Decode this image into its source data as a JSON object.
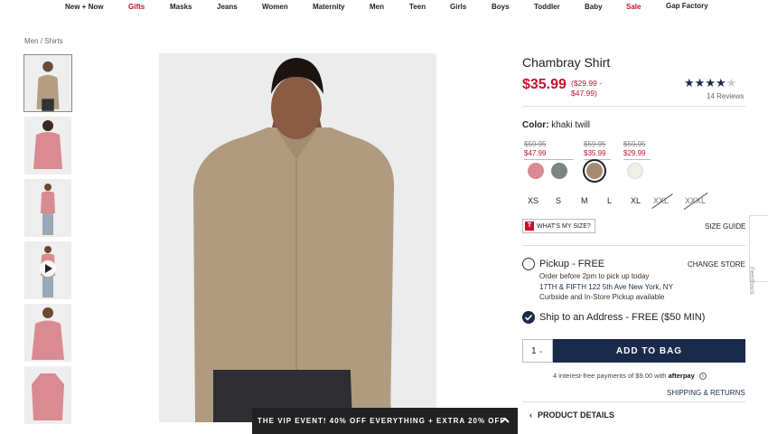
{
  "nav": {
    "items": [
      {
        "label": "New + Now",
        "sale": false
      },
      {
        "label": "Gifts",
        "sale": true
      },
      {
        "label": "Masks",
        "sale": false
      },
      {
        "label": "Jeans",
        "sale": false
      },
      {
        "label": "Women",
        "sale": false
      },
      {
        "label": "Maternity",
        "sale": false
      },
      {
        "label": "Men",
        "sale": false
      },
      {
        "label": "Teen",
        "sale": false
      },
      {
        "label": "Girls",
        "sale": false
      },
      {
        "label": "Boys",
        "sale": false
      },
      {
        "label": "Toddler",
        "sale": false
      },
      {
        "label": "Baby",
        "sale": false
      },
      {
        "label": "Sale",
        "sale": true
      },
      {
        "label": "Gap Factory",
        "sale": false
      }
    ]
  },
  "breadcrumb": "Men / Shirts",
  "product": {
    "title": "Chambray Shirt",
    "price": "$35.99",
    "price_range": "($29.99 - $47.99)",
    "rating": 4,
    "rating_max": 5,
    "reviews": "14 Reviews",
    "color_label": "Color:",
    "color_value": "khaki twill"
  },
  "swatch_prices": [
    {
      "old": "$59.95",
      "new": "$47.99"
    },
    {
      "old": "$59.95",
      "new": "$35.99"
    },
    {
      "old": "$59.95",
      "new": "$29.99"
    }
  ],
  "swatches": [
    {
      "name": "pink-chambray",
      "color": "#d98a92",
      "selected": false
    },
    {
      "name": "grey-chambray",
      "color": "#7c8582",
      "selected": false
    },
    {
      "name": "khaki-twill",
      "color": "#a58a72",
      "selected": true
    },
    {
      "name": "white",
      "color": "#efefe9",
      "selected": false
    }
  ],
  "sizes": [
    {
      "label": "XS",
      "available": true
    },
    {
      "label": "S",
      "available": true
    },
    {
      "label": "M",
      "available": true
    },
    {
      "label": "L",
      "available": true
    },
    {
      "label": "XL",
      "available": true
    },
    {
      "label": "XXL",
      "available": false
    },
    {
      "label": "XXXL",
      "available": false
    }
  ],
  "fit": {
    "icon_letter": "T",
    "label": "WHAT'S MY SIZE?"
  },
  "size_guide": "SIZE GUIDE",
  "pickup": {
    "label": "Pickup - FREE",
    "change_store": "CHANGE STORE",
    "line1": "Order before 2pm to pick up today",
    "line2": "17TH & FIFTH 122 5th Ave  New York, NY",
    "line3": "Curbside and In-Store Pickup available"
  },
  "ship": {
    "label": "Ship to an Address - FREE ($50 MIN)",
    "checked": true
  },
  "quantity": "1",
  "add_to_bag": "ADD TO BAG",
  "afterpay": {
    "text": "4 interest-free payments of $9.00 with",
    "brand": "afterpay",
    "info": "i"
  },
  "shipping_returns": "SHIPPING & RETURNS",
  "product_details": "PRODUCT DETAILS",
  "promo": "THE VIP EVENT! 40% OFF EVERYTHING + EXTRA 20% OFF",
  "feedback": "Feedback",
  "colors": {
    "sale_red": "#c8102e",
    "navy": "#1a2a4a"
  }
}
